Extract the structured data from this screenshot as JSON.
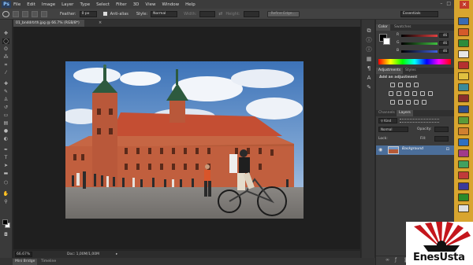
{
  "app": {
    "logo_text": "Ps"
  },
  "menu": [
    "File",
    "Edit",
    "Image",
    "Layer",
    "Type",
    "Select",
    "Filter",
    "3D",
    "View",
    "Window",
    "Help"
  ],
  "window_controls": {
    "minimize": "–",
    "maximize": "□",
    "close": "✕"
  },
  "options_bar": {
    "feather_label": "Feather:",
    "feather_value": "0 px",
    "antialias_label": "Anti-alias",
    "style_label": "Style:",
    "style_value": "Normal",
    "width_label": "Width:",
    "height_label": "Height:",
    "refine_edge": "Refine Edge...",
    "workspace": "Essentials"
  },
  "document": {
    "tab_title": "01_bnddrtrth.jpg @ 66.7% (RGB/8*)",
    "close_glyph": "×"
  },
  "status": {
    "zoom": "66.67%",
    "doc_size": "Doc: 1,00M/1,00M"
  },
  "bottom_tabs": [
    "Mini Bridge",
    "Timeline"
  ],
  "color_panel": {
    "tabs": [
      "Color",
      "Swatches"
    ],
    "sliders": [
      {
        "label": "R",
        "value": "46",
        "color": "#e04040"
      },
      {
        "label": "G",
        "value": "46",
        "color": "#40c040"
      },
      {
        "label": "B",
        "value": "46",
        "color": "#4060e0"
      }
    ]
  },
  "adjustments_panel": {
    "tabs": [
      "Adjustments",
      "Styles"
    ],
    "heading": "Add an adjustment"
  },
  "layers_panel": {
    "tabs": [
      "Channels",
      "Layers"
    ],
    "kind_label": "Kind",
    "blend_mode": "Normal",
    "opacity_label": "Opacity:",
    "lock_label": "Lock:",
    "fill_label": "Fill:",
    "layer_name": "Background"
  },
  "watermark": {
    "text": "EnesUsta"
  },
  "colors": {
    "accent_orange": "#d8a52f",
    "layer_selected": "#4b6e9a",
    "panel_bg": "#3b3b3b"
  }
}
